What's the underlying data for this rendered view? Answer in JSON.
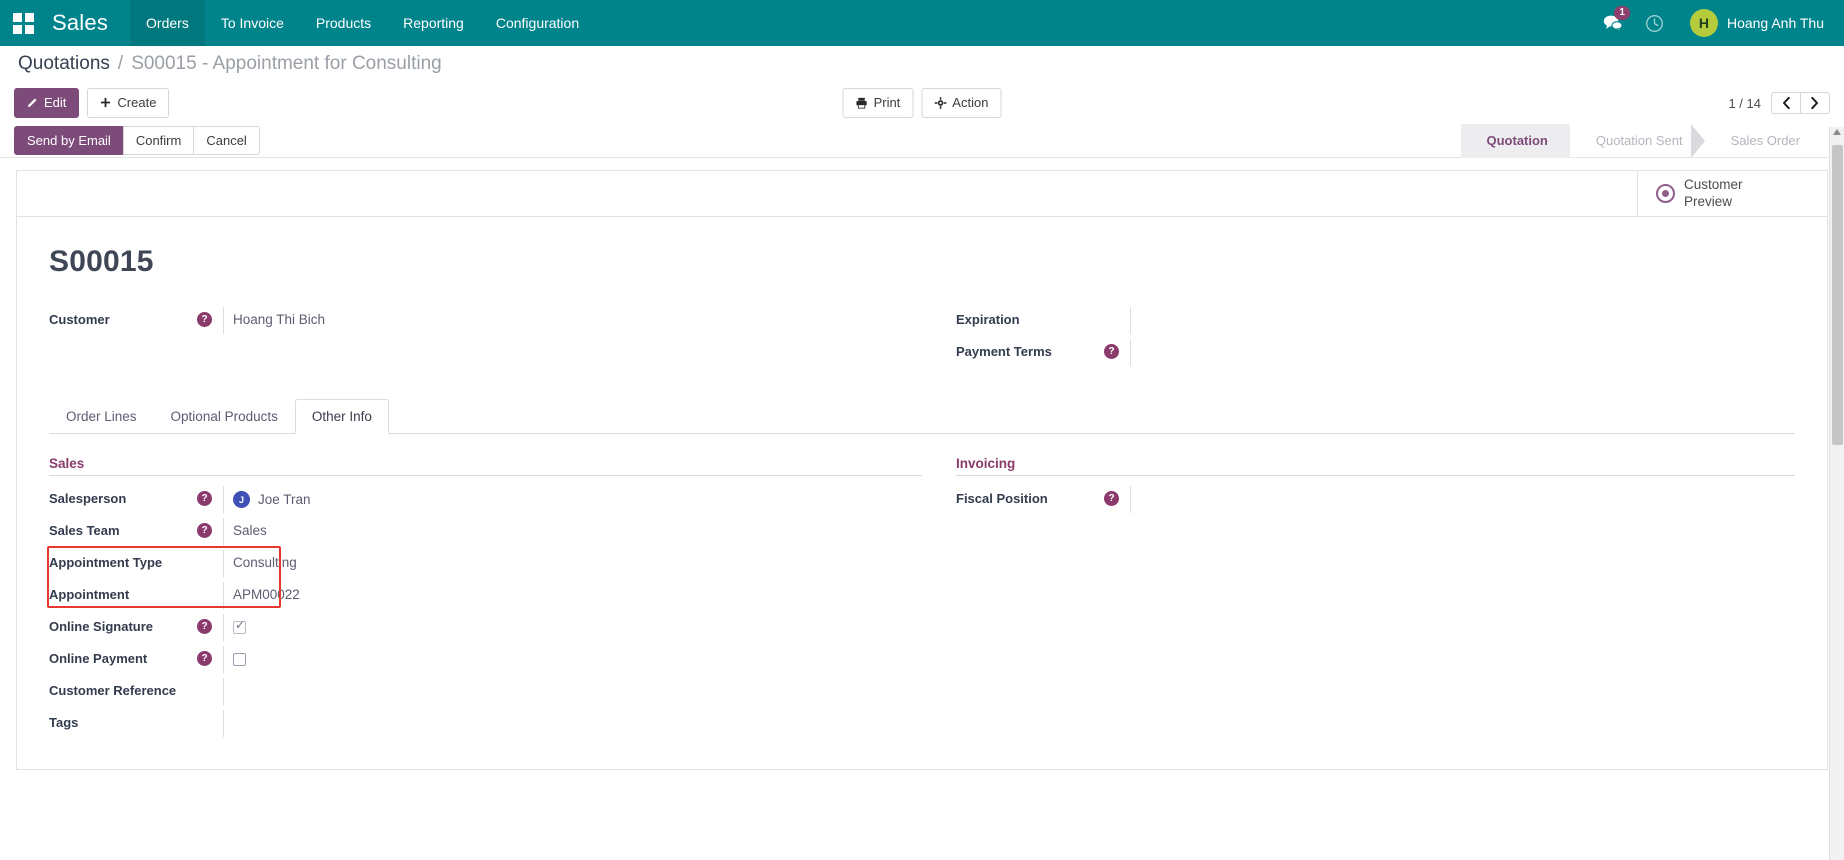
{
  "navbar": {
    "apps_icon": "apps-grid-icon",
    "brand": "Sales",
    "menu": [
      {
        "label": "Orders",
        "active": true
      },
      {
        "label": "To Invoice",
        "active": false
      },
      {
        "label": "Products",
        "active": false
      },
      {
        "label": "Reporting",
        "active": false
      },
      {
        "label": "Configuration",
        "active": false
      }
    ],
    "messages_icon": "chat-bubble-icon",
    "messages_count": "1",
    "activities_icon": "clock-icon",
    "user": {
      "initial": "H",
      "name": "Hoang Anh Thu"
    }
  },
  "breadcrumb": {
    "root": "Quotations",
    "separator": "/",
    "current": "S00015 - Appointment for Consulting"
  },
  "control_panel": {
    "edit_label": "Edit",
    "edit_icon": "pencil-icon",
    "create_label": "Create",
    "create_icon": "plus-icon",
    "print_label": "Print",
    "print_icon": "printer-icon",
    "action_label": "Action",
    "action_icon": "gear-icon",
    "pager": "1 / 14",
    "prev_icon": "chevron-left-icon",
    "next_icon": "chevron-right-icon"
  },
  "statusbar": {
    "buttons": [
      {
        "label": "Send by Email",
        "primary": true
      },
      {
        "label": "Confirm",
        "primary": false
      },
      {
        "label": "Cancel",
        "primary": false
      }
    ],
    "stages": [
      {
        "label": "Quotation",
        "active": true
      },
      {
        "label": "Quotation Sent",
        "active": false
      },
      {
        "label": "Sales Order",
        "active": false
      }
    ]
  },
  "sheet": {
    "stat_button": {
      "icon": "customer-preview-icon",
      "line1": "Customer",
      "line2": "Preview"
    },
    "record_title": "S00015",
    "header_fields": {
      "customer_label": "Customer",
      "customer_value": "Hoang Thi Bich",
      "expiration_label": "Expiration",
      "expiration_value": "",
      "payment_terms_label": "Payment Terms",
      "payment_terms_value": ""
    },
    "tabs": [
      {
        "label": "Order Lines",
        "active": false
      },
      {
        "label": "Optional Products",
        "active": false
      },
      {
        "label": "Other Info",
        "active": true
      }
    ],
    "other_info": {
      "sales_section_title": "Sales",
      "invoicing_section_title": "Invoicing",
      "salesperson_label": "Salesperson",
      "salesperson_initial": "J",
      "salesperson_value": "Joe Tran",
      "sales_team_label": "Sales Team",
      "sales_team_value": "Sales",
      "appointment_type_label": "Appointment Type",
      "appointment_type_value": "Consulting",
      "appointment_label": "Appointment",
      "appointment_value": "APM00022",
      "online_signature_label": "Online Signature",
      "online_signature_checked": true,
      "online_payment_label": "Online Payment",
      "online_payment_checked": false,
      "customer_reference_label": "Customer Reference",
      "customer_reference_value": "",
      "tags_label": "Tags",
      "tags_value": "",
      "fiscal_position_label": "Fiscal Position",
      "fiscal_position_value": ""
    }
  },
  "help_glyph": "?",
  "colors": {
    "navbar_teal": "#00848b",
    "accent_purple": "#7d4b79",
    "section_purple": "#8a3b6b",
    "highlight_red": "#e8372e",
    "badge_purple": "#8f3f6d",
    "avatar_green": "#b4cb3c"
  }
}
